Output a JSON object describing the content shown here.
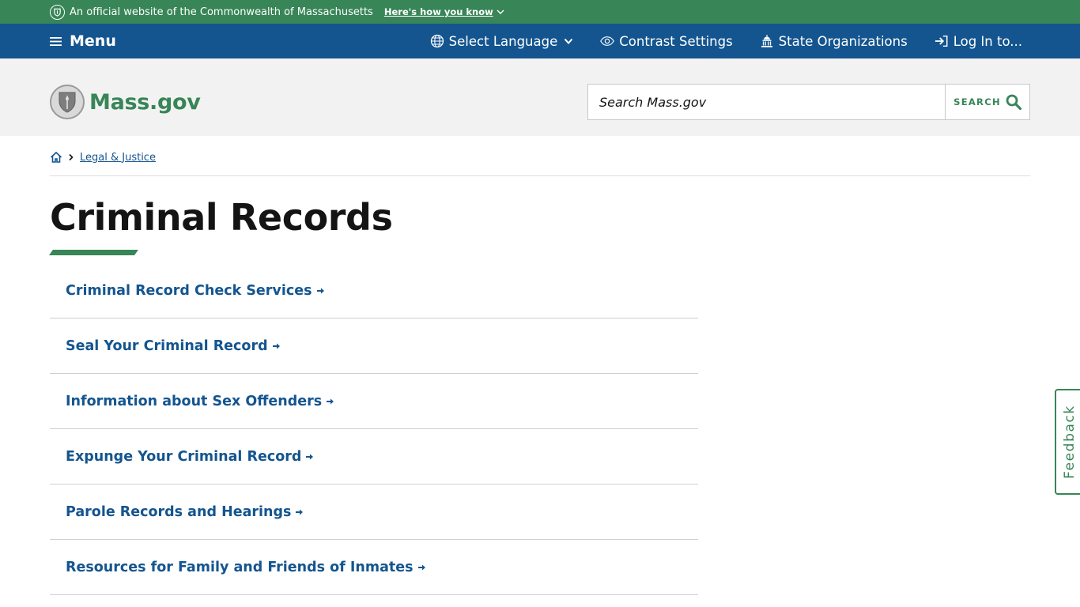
{
  "official_banner": {
    "text": "An official website of the Commonwealth of Massachusetts",
    "how_link": "Here's how you know"
  },
  "utility_nav": {
    "menu_label": "Menu",
    "language": "Select Language",
    "contrast": "Contrast Settings",
    "state_orgs": "State Organizations",
    "login": "Log In to..."
  },
  "header": {
    "logo_text": "Mass.gov",
    "search_placeholder": "Search Mass.gov",
    "search_button": "SEARCH"
  },
  "breadcrumb": {
    "items": [
      "Legal & Justice"
    ]
  },
  "page": {
    "title": "Criminal Records",
    "links": [
      "Criminal Record Check Services",
      "Seal Your Criminal Record",
      "Information about Sex Offenders",
      "Expunge Your Criminal Record",
      "Parole Records and Hearings",
      "Resources for Family and Friends of Inmates"
    ]
  },
  "feedback": {
    "label": "Feedback"
  },
  "colors": {
    "green": "#388557",
    "blue": "#14558f",
    "header_bg": "#f2f2f2"
  }
}
